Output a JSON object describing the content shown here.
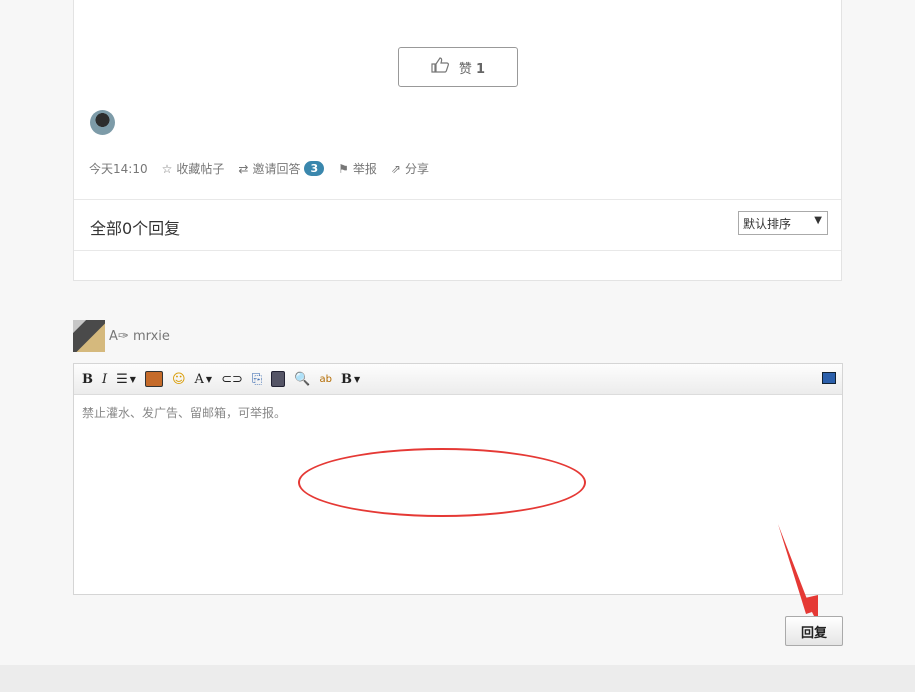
{
  "post": {
    "like_label": "赞",
    "like_count": "1",
    "time": "今天14:10",
    "favorite": "收藏帖子",
    "invite": "邀请回答",
    "invite_count": "3",
    "report": "举报",
    "share": "分享"
  },
  "replies": {
    "title": "全部0个回复",
    "sort_value": "默认排序"
  },
  "composer": {
    "user_prefix": "A✑",
    "username": "mrxie",
    "placeholder": "禁止灌水、发广告、留邮箱，可举报。",
    "submit_label": "回复"
  },
  "toolbar": {
    "bold": "B",
    "italic": "I",
    "font_color": "A",
    "bold2": "B"
  },
  "colors": {
    "accent": "#3a87ad",
    "annotation": "#e53935"
  }
}
